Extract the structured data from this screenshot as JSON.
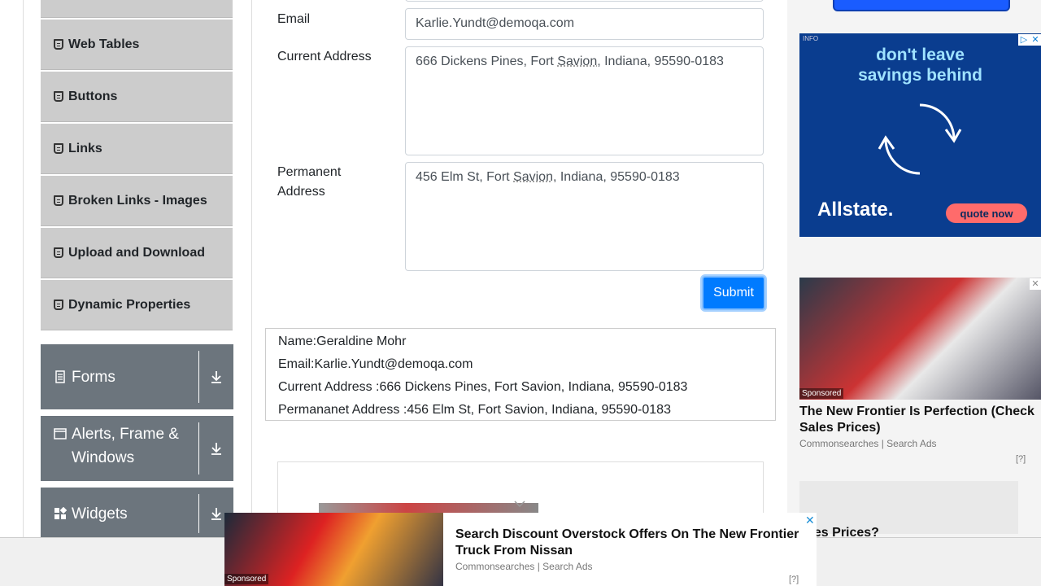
{
  "sidebar": {
    "elements_items": [
      {
        "label": "Web Tables"
      },
      {
        "label": "Buttons"
      },
      {
        "label": "Links"
      },
      {
        "label": "Broken Links - Images"
      },
      {
        "label": "Upload and Download"
      },
      {
        "label": "Dynamic Properties"
      }
    ],
    "groups": [
      {
        "label": "Forms"
      },
      {
        "label": "Alerts, Frame & Windows"
      },
      {
        "label": "Widgets"
      }
    ]
  },
  "form": {
    "email_label": "Email",
    "email_value": "Karlie.Yundt@demoqa.com",
    "current_address_label": "Current Address",
    "current_address_pre": "666 Dickens Pines, Fort ",
    "current_address_word": "Savion",
    "current_address_post": ", Indiana, 95590-0183",
    "permanent_address_label_1": "Permanent",
    "permanent_address_label_2": "Address",
    "permanent_address_pre": "456 Elm St, Fort ",
    "permanent_address_word": "Savion",
    "permanent_address_post": ", Indiana, 95590-0183",
    "submit_label": "Submit"
  },
  "output": {
    "name": "Name:Geraldine Mohr",
    "email": "Email:Karlie.Yundt@demoqa.com",
    "current_address": "Current Address :666 Dickens Pines, Fort Savion, Indiana, 95590-0183",
    "permanent_address": "Permananet Address :456 Elm St, Fort Savion, Indiana, 95590-0183"
  },
  "ads": {
    "allstate": {
      "info": "INFO",
      "message_1": "don't leave",
      "message_2": "savings behind",
      "brand": "Allstate.",
      "cta": "quote now"
    },
    "nissan_side": {
      "sponsored": "Sponsored",
      "title": "The New Frontier Is Perfection (Check Sales Prices)",
      "source": "Commonsearches | Search Ads",
      "q": "[?]"
    },
    "peek_text": "ces Prices?",
    "bottom": {
      "sponsored": "Sponsored",
      "title": "Search Discount Overstock Offers On The New Frontier Truck From Nissan",
      "source": "Commonsearches | Search Ads",
      "q": "[?]",
      "close": "✕"
    }
  }
}
